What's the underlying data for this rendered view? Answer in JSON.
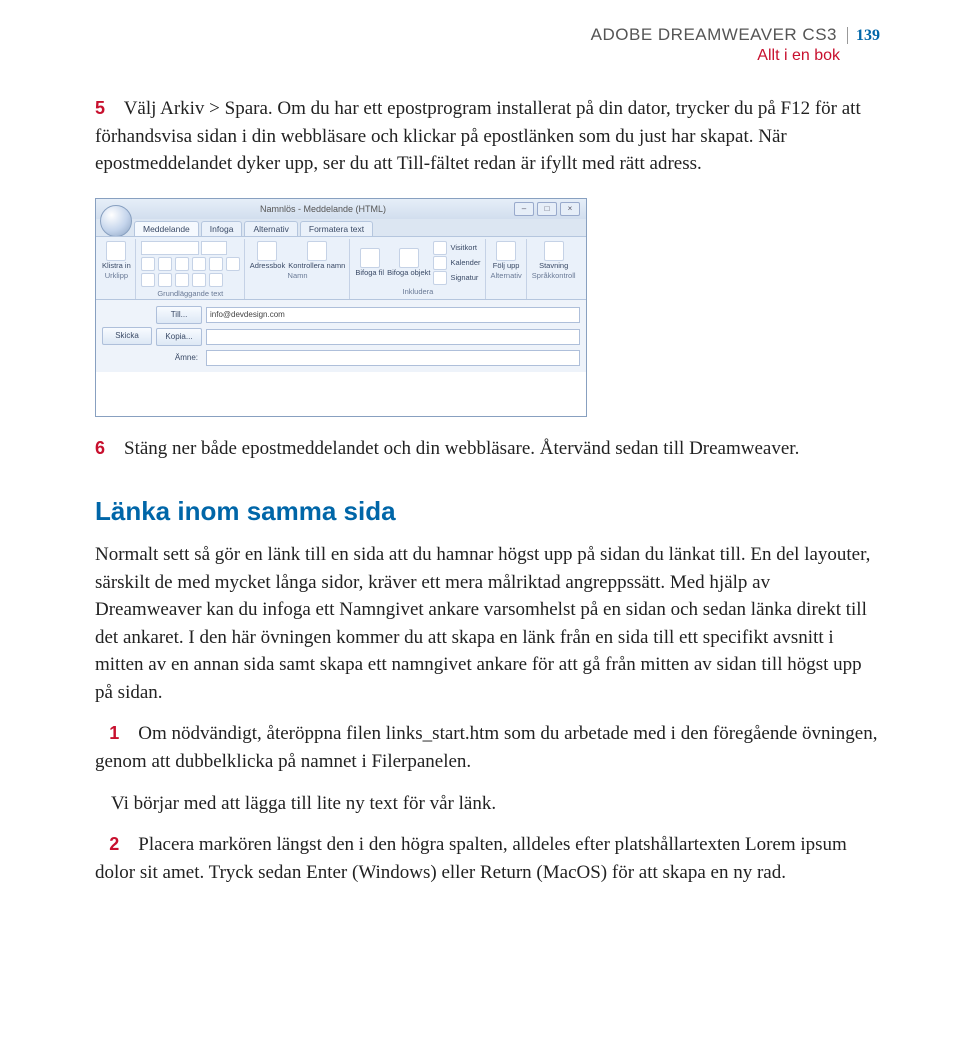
{
  "header": {
    "product": "ADOBE DREAMWEAVER CS3",
    "page_number": "139",
    "subtitle": "Allt i en bok"
  },
  "step5": {
    "num": "5",
    "text": "Välj Arkiv > Spara. Om du har ett epostprogram installerat på din dator, trycker du på F12 för att förhandsvisa sidan i din webbläsare och klickar på epostlänken som du just har skapat. När epostmeddelandet dyker upp, ser du att Till-fältet redan är ifyllt med rätt adress."
  },
  "figure": {
    "title": "Namnlös - Meddelande (HTML)",
    "tabs": [
      "Meddelande",
      "Infoga",
      "Alternativ",
      "Formatera text"
    ],
    "ribbon": {
      "clipboard": {
        "btn": "Klistra in",
        "label": "Urklipp"
      },
      "font": {
        "label": "Grundläggande text"
      },
      "names": {
        "btn1": "Adressbok",
        "btn2": "Kontrollera namn",
        "label": "Namn"
      },
      "include": {
        "btn1": "Bifoga fil",
        "btn2": "Bifoga objekt",
        "side1": "Visitkort",
        "side2": "Kalender",
        "side3": "Signatur",
        "label": "Inkludera"
      },
      "options": {
        "btn": "Följ upp",
        "label": "Alternativ"
      },
      "proof": {
        "btn": "Stavning",
        "label": "Språkkontroll"
      }
    },
    "fields": {
      "send": "Skicka",
      "to": "Till...",
      "to_value": "info@devdesign.com",
      "cc": "Kopia...",
      "subject": "Ämne:"
    }
  },
  "step6": {
    "num": "6",
    "text": "Stäng ner både epostmeddelandet och din webbläsare. Återvänd sedan till Dreamweaver."
  },
  "section": {
    "heading": "Länka inom samma sida",
    "intro": "Normalt sett så gör en länk till en sida att du hamnar högst upp på sidan du länkat till. En del layouter, särskilt de med mycket långa sidor, kräver ett mera målriktad angreppssätt. Med hjälp av Dreamweaver kan du infoga ett Namngivet ankare varsomhelst på en sidan och sedan länka direkt till det ankaret. I den här övningen kommer du att skapa en länk från en sida till ett specifikt avsnitt i mitten av en annan sida samt skapa ett namngivet ankare för att gå från mitten av sidan till högst upp på sidan."
  },
  "step1": {
    "num": "1",
    "text": "Om nödvändigt, återöppna filen links_start.htm som du arbetade med i den föregående övningen, genom att dubbelklicka på namnet i Filerpanelen.",
    "after": "Vi börjar med att lägga till lite ny text för vår länk."
  },
  "step2": {
    "num": "2",
    "text": "Placera markören längst den i den högra spalten, alldeles efter platshållartexten Lorem ipsum dolor sit amet. Tryck sedan Enter (Windows) eller Return (MacOS) för att skapa en ny rad."
  }
}
